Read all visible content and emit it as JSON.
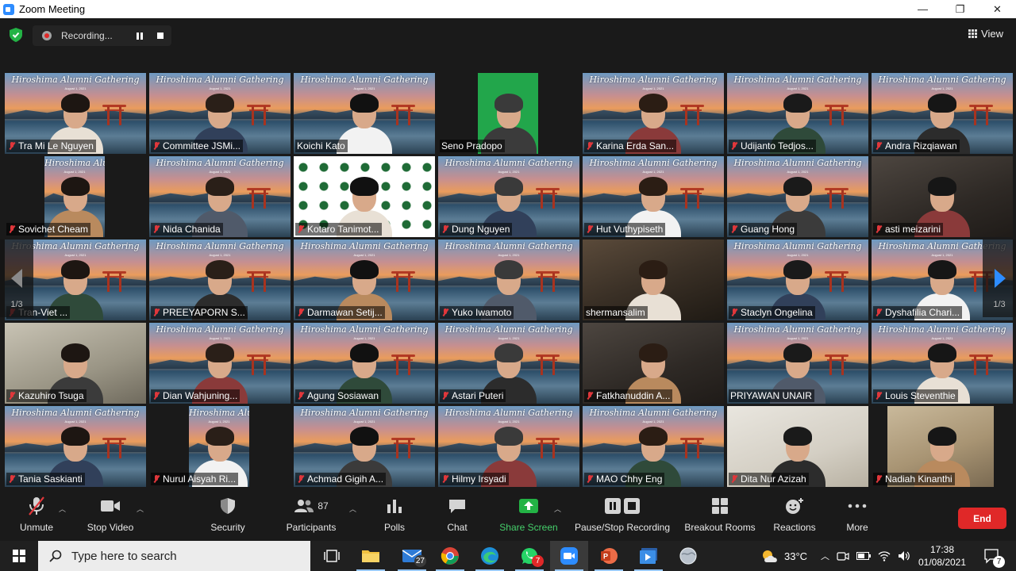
{
  "window": {
    "title": "Zoom Meeting",
    "minimize": "—",
    "restore": "❐",
    "close": "✕"
  },
  "recording": {
    "label": "Recording..."
  },
  "view": {
    "label": "View"
  },
  "banner": {
    "title": "Hiroshima Alumni Gathering",
    "date": "August 1, 2021"
  },
  "participants_grid": [
    {
      "name": "Tra Mi Le Nguyen",
      "muted": true
    },
    {
      "name": "Committee JSMi...",
      "muted": true
    },
    {
      "name": "Koichi Kato",
      "muted": false
    },
    {
      "name": "Seno Pradopo",
      "muted": false
    },
    {
      "name": "Karina Erda San...",
      "muted": true
    },
    {
      "name": "Udijanto Tedjos...",
      "muted": true
    },
    {
      "name": "Andra Rizqiawan",
      "muted": true
    },
    {
      "name": "Sovichet Cheam",
      "muted": true
    },
    {
      "name": "Nida Chanida",
      "muted": true
    },
    {
      "name": "Kotaro Tanimot...",
      "muted": true
    },
    {
      "name": "Dung Nguyen",
      "muted": true
    },
    {
      "name": "Hut Vuthypiseth",
      "muted": true
    },
    {
      "name": "Guang Hong",
      "muted": true
    },
    {
      "name": "asti meizarini",
      "muted": true
    },
    {
      "name": "Tran-Viet ...",
      "muted": true
    },
    {
      "name": "PREEYAPORN S...",
      "muted": true
    },
    {
      "name": "Darmawan Setij...",
      "muted": true
    },
    {
      "name": "Yuko Iwamoto",
      "muted": true
    },
    {
      "name": "shermansalim",
      "muted": false
    },
    {
      "name": "Staclyn Ongelina",
      "muted": true
    },
    {
      "name": "Dyshafilia Chari...",
      "muted": true
    },
    {
      "name": "Kazuhiro Tsuga",
      "muted": true
    },
    {
      "name": "Dian Wahjuning...",
      "muted": true
    },
    {
      "name": "Agung Sosiawan",
      "muted": true
    },
    {
      "name": "Astari Puteri",
      "muted": true
    },
    {
      "name": "Fatkhanuddin A...",
      "muted": true
    },
    {
      "name": "PRIYAWAN UNAIR",
      "muted": false
    },
    {
      "name": "Louis Steventhie",
      "muted": true
    },
    {
      "name": "Tania Saskianti",
      "muted": true
    },
    {
      "name": "Nurul Aisyah Ri...",
      "muted": true
    },
    {
      "name": "Achmad Gigih A...",
      "muted": true
    },
    {
      "name": "Hilmy Irsyadi",
      "muted": true
    },
    {
      "name": "MAO Chhy Eng",
      "muted": true
    },
    {
      "name": "Dita Nur Azizah",
      "muted": true
    },
    {
      "name": "Nadiah Kinanthi",
      "muted": true
    }
  ],
  "pagination": {
    "left": "1/3",
    "right": "1/3"
  },
  "controls": {
    "unmute": "Unmute",
    "stop_video": "Stop Video",
    "security": "Security",
    "participants": "Participants",
    "participants_count": "87",
    "polls": "Polls",
    "chat": "Chat",
    "share_screen": "Share Screen",
    "pause_stop_recording": "Pause/Stop Recording",
    "breakout_rooms": "Breakout Rooms",
    "reactions": "Reactions",
    "more": "More",
    "end": "End"
  },
  "taskbar": {
    "search_placeholder": "Type here to search",
    "mail_badge": "27",
    "whatsapp_badge": "7",
    "temperature": "33°C",
    "time": "17:38",
    "date": "01/08/2021",
    "notifications": "7"
  },
  "colors": {
    "accent_active_speaker": "#d6e05b",
    "end_button": "#e02828",
    "share_green": "#45d06b",
    "mute_red": "#e0373b",
    "zoom_blue": "#2D8CFF"
  }
}
